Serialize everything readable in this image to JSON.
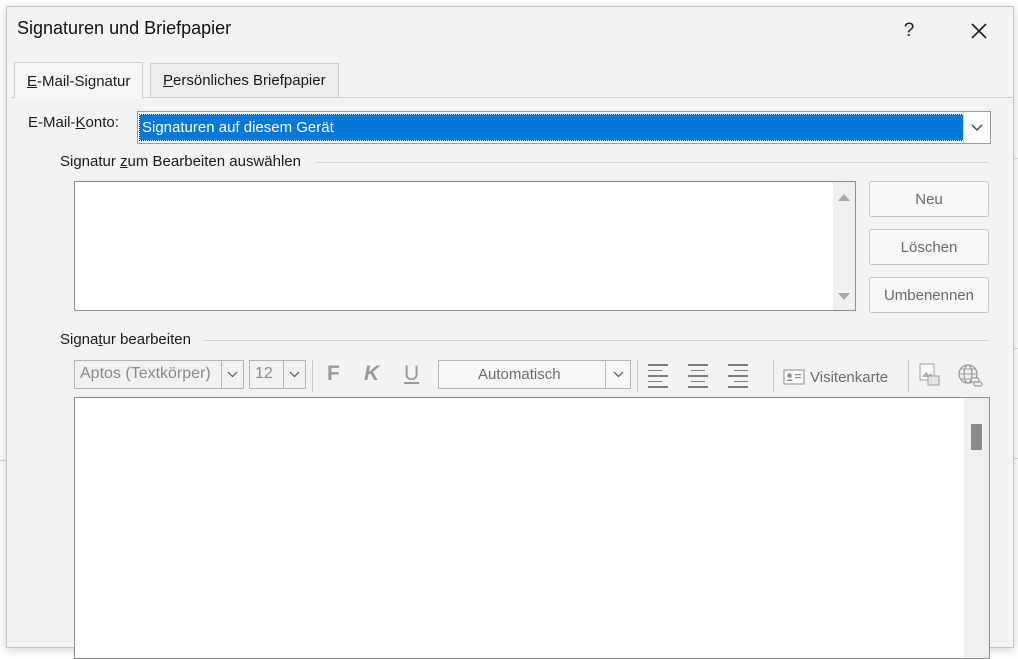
{
  "dialog": {
    "title": "Signaturen und Briefpapier",
    "help_label": "?",
    "close_label": "✕"
  },
  "tabs": [
    {
      "prefix": "",
      "accel": "E",
      "rest": "-Mail-Signatur"
    },
    {
      "prefix": "",
      "accel": "P",
      "rest": "ersönliches Briefpapier"
    }
  ],
  "account": {
    "label_prefix": "E-Mail-",
    "label_accel": "K",
    "label_rest": "onto:",
    "selected": "Signaturen auf diesem Gerät"
  },
  "select_group": {
    "title_prefix": "Signatur ",
    "title_accel": "z",
    "title_rest": "um Bearbeiten auswählen",
    "items": []
  },
  "buttons": {
    "new": "Neu",
    "delete": "Löschen",
    "rename": "Umbenennen"
  },
  "edit_group": {
    "title_prefix": "Signa",
    "title_accel": "t",
    "title_rest": "ur bearbeiten"
  },
  "toolbar": {
    "font": "Aptos (Textkörper)",
    "size": "12",
    "bold": "F",
    "italic": "K",
    "underline": "U",
    "color": "Automatisch",
    "business_card": "Visitenkarte"
  },
  "editor": {
    "content": ""
  }
}
